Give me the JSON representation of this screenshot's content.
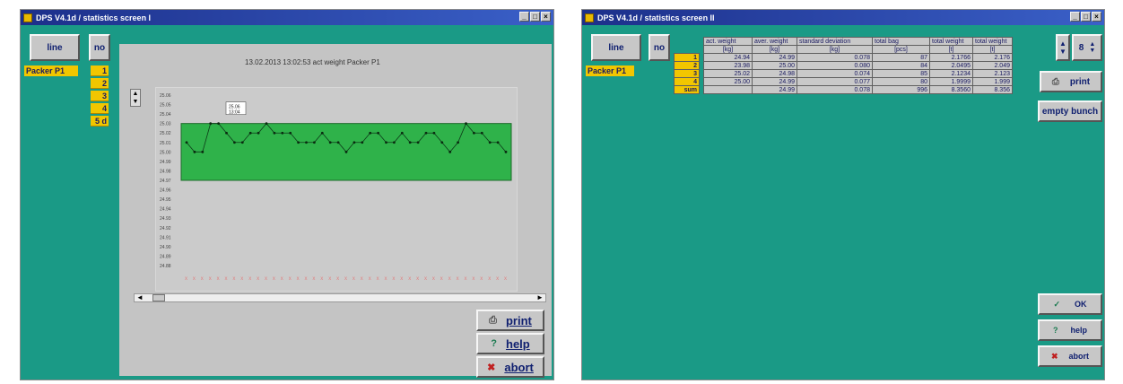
{
  "window1": {
    "title": "DPS V4.1d / statistics screen I",
    "header": {
      "line_button": "line",
      "no_button": "no"
    },
    "line_label": "Packer P1",
    "numbers": [
      "1",
      "2",
      "3",
      "4",
      "5 d"
    ],
    "chart": {
      "title": "13.02.2013 13:02:53 act weight Packer P1",
      "marker_label": "25.06\n13:04",
      "y_ticks": [
        "25.06",
        "25.05",
        "25.04",
        "25.03",
        "25.02",
        "25.01",
        "25.00",
        "24.99",
        "24.98",
        "24.97",
        "24.96",
        "24.95",
        "24.94",
        "24.93",
        "24.92",
        "24.91",
        "24.90",
        "24.89",
        "24.88"
      ]
    },
    "buttons": {
      "print": "print",
      "help": "help",
      "abort": "abort"
    }
  },
  "window2": {
    "title": "DPS V4.1d / statistics screen II",
    "header": {
      "line_button": "line",
      "no_button": "no"
    },
    "line_label": "Packer P1",
    "columns": [
      {
        "name": "act. weight",
        "unit": "[kg]"
      },
      {
        "name": "aver. weight",
        "unit": "[kg]"
      },
      {
        "name": "standard deviation",
        "unit": "[kg]"
      },
      {
        "name": "total bag",
        "unit": "[pcs]"
      },
      {
        "name": "total weight",
        "unit": "[t]"
      },
      {
        "name": "total weight",
        "unit": "[t]"
      }
    ],
    "rows": [
      {
        "no": "1",
        "cells": [
          "24.94",
          "24.99",
          "0.078",
          "87",
          "2.1766",
          "2.176"
        ]
      },
      {
        "no": "2",
        "cells": [
          "23.98",
          "25.00",
          "0.080",
          "84",
          "2.0495",
          "2.049"
        ]
      },
      {
        "no": "3",
        "cells": [
          "25.02",
          "24.98",
          "0.074",
          "85",
          "2.1234",
          "2.123"
        ]
      },
      {
        "no": "4",
        "cells": [
          "25.00",
          "24.99",
          "0.077",
          "80",
          "1.9999",
          "1.999"
        ]
      },
      {
        "no": "sum",
        "cells": [
          "",
          "24.99",
          "0.078",
          "996",
          "8.3560",
          "8.356"
        ]
      }
    ],
    "spinner_value": "8",
    "buttons": {
      "print": "print",
      "empty_bunch": "empty bunch",
      "ok": "OK",
      "help": "help",
      "abort": "abort"
    }
  },
  "chart_data": {
    "type": "line",
    "title": "13.02.2013 13:02:53 act weight Packer P1",
    "ylim": [
      24.88,
      25.06
    ],
    "band": [
      24.97,
      25.03
    ],
    "y": [
      25.01,
      25.0,
      25.0,
      25.03,
      25.03,
      25.02,
      25.01,
      25.01,
      25.02,
      25.02,
      25.03,
      25.02,
      25.02,
      25.02,
      25.01,
      25.01,
      25.01,
      25.02,
      25.01,
      25.01,
      25.0,
      25.01,
      25.01,
      25.02,
      25.02,
      25.01,
      25.01,
      25.02,
      25.01,
      25.01,
      25.02,
      25.02,
      25.01,
      25.0,
      25.01,
      25.03,
      25.02,
      25.02,
      25.01,
      25.01,
      25.0
    ]
  }
}
